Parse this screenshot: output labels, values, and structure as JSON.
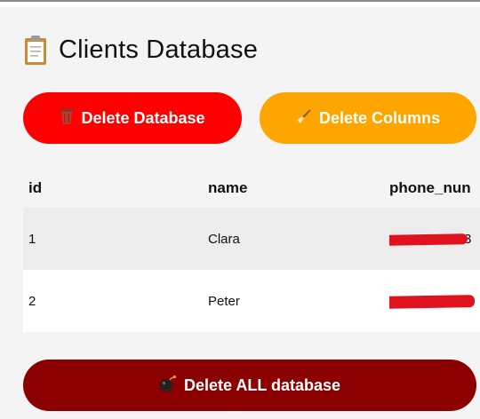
{
  "header": {
    "title": "Clients Database",
    "icon": "clipboard-icon"
  },
  "buttons": {
    "delete_database": {
      "label": "Delete Database",
      "icon": "wastebasket-icon",
      "color": "#ff0000"
    },
    "delete_columns": {
      "label": "Delete Columns",
      "icon": "broom-icon",
      "color": "#ffa500"
    },
    "delete_all": {
      "label": "Delete ALL database",
      "icon": "bomb-icon",
      "color": "#8b0000"
    }
  },
  "table": {
    "columns": [
      "id",
      "name",
      "phone_nun"
    ],
    "rows": [
      {
        "id": "1",
        "name": "Clara",
        "phone_tail": "3",
        "phone_redacted": true
      },
      {
        "id": "2",
        "name": "Peter",
        "phone_tail": "",
        "phone_redacted": true
      }
    ]
  },
  "colors": {
    "redaction": "#e0121e",
    "stripe": "#ececec"
  }
}
